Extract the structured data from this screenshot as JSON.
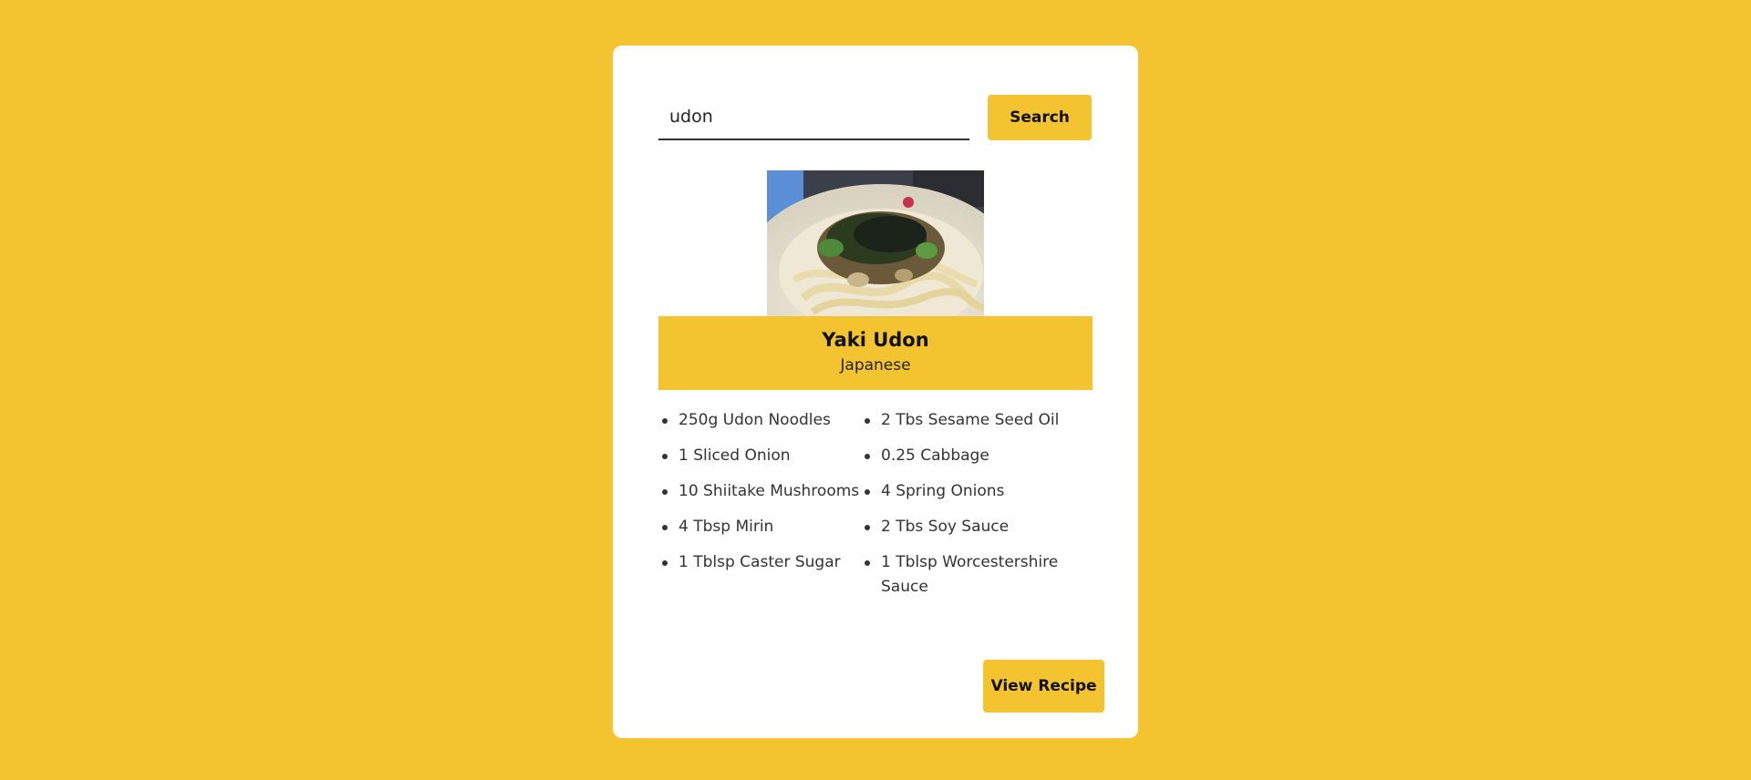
{
  "search": {
    "value": "udon",
    "button_label": "Search"
  },
  "recipe": {
    "title": "Yaki Udon",
    "cuisine": "Japanese",
    "ingredients": [
      "250g Udon Noodles",
      "2 Tbs Sesame Seed Oil",
      "1 Sliced Onion",
      "0.25 Cabbage",
      "10 Shiitake Mushrooms",
      "4 Spring Onions",
      "4 Tbsp Mirin",
      "2 Tbs Soy Sauce",
      "1 Tblsp Caster Sugar",
      "1 Tblsp Worcestershire Sauce"
    ],
    "view_button_label": "View Recipe"
  },
  "colors": {
    "accent": "#f4c430",
    "card": "#ffffff"
  }
}
